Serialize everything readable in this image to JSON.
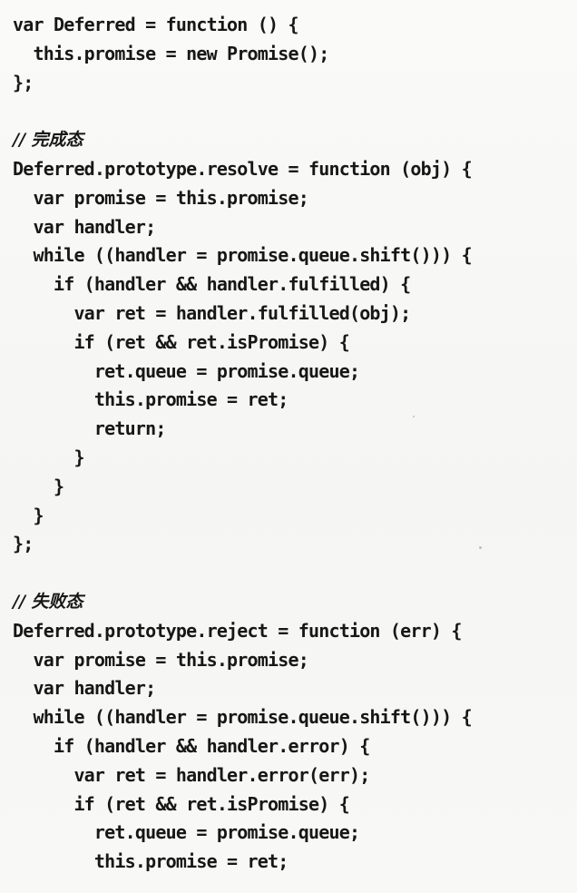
{
  "code_block": {
    "lines": [
      "var Deferred = function () {",
      "  this.promise = new Promise();",
      "};",
      "",
      "// 完成态",
      "Deferred.prototype.resolve = function (obj) {",
      "  var promise = this.promise;",
      "  var handler;",
      "  while ((handler = promise.queue.shift())) {",
      "    if (handler && handler.fulfilled) {",
      "      var ret = handler.fulfilled(obj);",
      "      if (ret && ret.isPromise) {",
      "        ret.queue = promise.queue;",
      "        this.promise = ret;",
      "        return;",
      "      }",
      "    }",
      "  }",
      "};",
      "",
      "// 失败态",
      "Deferred.prototype.reject = function (err) {",
      "  var promise = this.promise;",
      "  var handler;",
      "  while ((handler = promise.queue.shift())) {",
      "    if (handler && handler.error) {",
      "      var ret = handler.error(err);",
      "      if (ret && ret.isPromise) {",
      "        ret.queue = promise.queue;",
      "        this.promise = ret;"
    ]
  }
}
